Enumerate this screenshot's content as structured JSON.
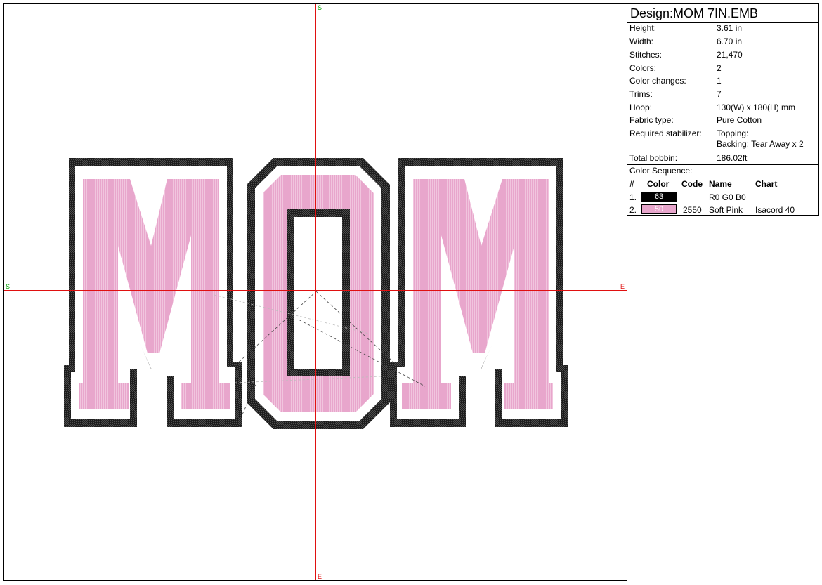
{
  "canvas": {
    "axis_start": "S",
    "axis_end": "E",
    "crosshair_color": "#e01010",
    "axis_label_color_start": "#00a000",
    "axis_label_color_end": "#e01010"
  },
  "design": {
    "letters": [
      "M",
      "O",
      "M"
    ],
    "fill_color": "#e8a6cc",
    "outline_color": "#111111",
    "gap_color": "#ffffff"
  },
  "info": {
    "title": "Design:MOM 7IN.EMB",
    "properties": [
      {
        "label": "Height:",
        "value": "3.61 in"
      },
      {
        "label": "Width:",
        "value": "6.70 in"
      },
      {
        "label": "Stitches:",
        "value": "21,470"
      },
      {
        "label": "Colors:",
        "value": "2"
      },
      {
        "label": "Color changes:",
        "value": "1"
      },
      {
        "label": "Trims:",
        "value": "7"
      },
      {
        "label": "Hoop:",
        "value": "130(W) x 180(H) mm"
      },
      {
        "label": "Fabric type:",
        "value": "Pure Cotton"
      },
      {
        "label": "Required stabilizer:",
        "value": "Topping:",
        "value2": "Backing: Tear Away x 2"
      },
      {
        "label": "Total bobbin:",
        "value": "186.02ft"
      }
    ],
    "sequence_title": "Color Sequence:",
    "sequence_headers": {
      "num": "#",
      "color": "Color",
      "code": "Code",
      "name": "Name",
      "chart": "Chart"
    },
    "sequence": [
      {
        "num": "1.",
        "swatch_label": "63",
        "swatch_color": "#000000",
        "swatch_text_color": "#ffffff",
        "code": "",
        "name": "R0 G0 B0",
        "chart": ""
      },
      {
        "num": "2.",
        "swatch_label": "50",
        "swatch_color": "#e8a6cc",
        "swatch_text_color": "#ffffff",
        "code": "2550",
        "name": "Soft Pink",
        "chart": "Isacord 40"
      }
    ]
  }
}
